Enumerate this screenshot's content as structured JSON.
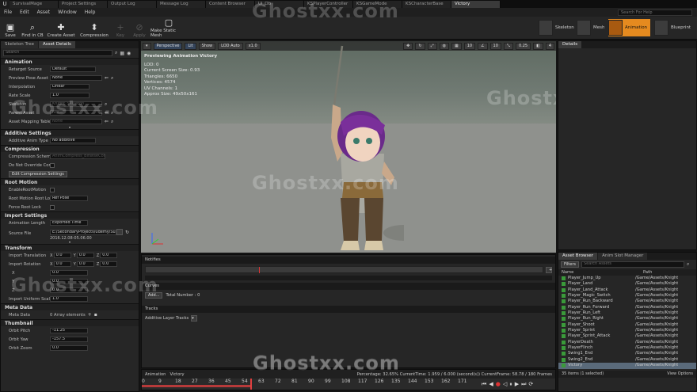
{
  "tabs": [
    "SurvivalMage",
    "Project Settings",
    "Output Log",
    "Message Log",
    "Content Browser",
    "Ui_Ob",
    "KSPlayerController",
    "KSGameMode",
    "KSCharacterBase",
    "Victory"
  ],
  "menu": [
    "File",
    "Edit",
    "Asset",
    "Window",
    "Help"
  ],
  "help_search": "Search For Help",
  "toolbar": {
    "save": "Save",
    "find": "Find in CB",
    "create": "Create Asset",
    "compression": "Compression",
    "key": "Key",
    "apply": "Apply",
    "static_mesh": "Make Static Mesh"
  },
  "modes": {
    "skeleton": "Skeleton",
    "mesh": "Mesh",
    "animation": "Animation",
    "blueprint": "Blueprint"
  },
  "left_tabs": [
    "Skeleton Tree",
    "Asset Details"
  ],
  "search_placeholder": "Search",
  "animation": {
    "header": "Animation",
    "retarget_label": "Retarget Source",
    "retarget_value": "Default",
    "preview_label": "Preview Pose Asset",
    "preview_value": "None",
    "interp_label": "Interpolation",
    "interp_value": "Linear",
    "rate_label": "Rate Scale",
    "rate_value": "1.0",
    "skeleton_label": "Skeleton",
    "skeleton_value": "Knight_Skeleton",
    "parent_label": "Parent Asset",
    "parent_value": "None",
    "mapping_label": "Asset Mapping Table",
    "mapping_value": "None"
  },
  "additive": {
    "header": "Additive Settings",
    "type_label": "Additive Anim Type",
    "type_value": "No additive"
  },
  "compression": {
    "header": "Compression",
    "scheme_label": "Compression Scheme",
    "scheme_value": "AnimCompress_BitwiseCompr",
    "override_label": "Do Not Override Com",
    "edit_btn": "Edit Compression Settings"
  },
  "root": {
    "header": "Root Motion",
    "enable_label": "EnableRootMotion",
    "lock_label": "Root Motion Root Loc",
    "lock_value": "Ref Pose",
    "force_label": "Force Root Lock"
  },
  "import": {
    "header": "Import Settings",
    "length_label": "Animation Length",
    "length_value": "Exported Time",
    "source_label": "Source File",
    "source_value": "E:/SecondaryProjects/udemy/Surviv",
    "source_date": "2016.12.08-05.06.00"
  },
  "transform": {
    "header": "Transform",
    "trans_label": "Import Translation",
    "rot_label": "Import Rotation",
    "uni_label": "Import Uniform Scale",
    "x": "X",
    "y": "Y",
    "z": "Z",
    "zero": "0.0",
    "one": "1.0"
  },
  "meta": {
    "header": "Meta Data",
    "label": "Meta Data",
    "value": "0 Array elements"
  },
  "thumb": {
    "header": "Thumbnail",
    "pitch_label": "Orbit Pitch",
    "pitch": "-11.25",
    "yaw_label": "Orbit Yaw",
    "yaw": "-157.5",
    "zoom_label": "Orbit Zoom",
    "zoom": "0.0"
  },
  "viewport": {
    "perspective": "Perspective",
    "lit": "Lit",
    "show": "Show",
    "lod": "LOD Auto",
    "speed": "x1.0",
    "grid": "10",
    "angle": "10",
    "scale": "0.25",
    "cam": "4",
    "stats": [
      "Previewing Animation Victory",
      "LOD: 0",
      "Current Screen Size: 0.93",
      "Triangles: 6650",
      "Vertices: 4574",
      "UV Channels: 1",
      "Approx Size: 49x50x161"
    ]
  },
  "notifies_label": "Notifies",
  "curves_label": "Curves",
  "add_btn": "Add...",
  "total": "Total Number : 0",
  "tracks_label": "Tracks",
  "additive_tracks": "Additive Layer Tracks",
  "timeline": {
    "anim": "Animation",
    "name": "Victory",
    "info": "Percentage: 32.65% CurrentTime: 1.959 / 6.000 (second(s)) CurrentFrame: 58.78 / 180 Frames",
    "ticks": [
      "0",
      "9",
      "18",
      "27",
      "36",
      "45",
      "54",
      "63",
      "72",
      "81",
      "90",
      "99",
      "108",
      "117",
      "126",
      "135",
      "144",
      "153",
      "162",
      "171"
    ]
  },
  "details_tab": "Details",
  "assets": {
    "tabs": [
      "Asset Browser",
      "Anim Slot Manager"
    ],
    "filters": "Filters",
    "search": "Search Assets",
    "col_name": "Name",
    "col_path": "Path",
    "items": [
      {
        "n": "Player_Jump_Up",
        "p": "/Game/Assets/Knight"
      },
      {
        "n": "Player_Land",
        "p": "/Game/Assets/Knight"
      },
      {
        "n": "Player_Land_Attack",
        "p": "/Game/Assets/Knight"
      },
      {
        "n": "Player_Magic_Switch",
        "p": "/Game/Assets/Knight"
      },
      {
        "n": "Player_Run_Backward",
        "p": "/Game/Assets/Knight"
      },
      {
        "n": "Player_Run_Forward",
        "p": "/Game/Assets/Knight"
      },
      {
        "n": "Player_Run_Left",
        "p": "/Game/Assets/Knight"
      },
      {
        "n": "Player_Run_Right",
        "p": "/Game/Assets/Knight"
      },
      {
        "n": "Player_Shoot",
        "p": "/Game/Assets/Knight"
      },
      {
        "n": "Player_Sprint",
        "p": "/Game/Assets/Knight"
      },
      {
        "n": "Player_Sprint_Attack",
        "p": "/Game/Assets/Knight"
      },
      {
        "n": "PlayerDeath",
        "p": "/Game/Assets/Knight"
      },
      {
        "n": "PlayerFlinch",
        "p": "/Game/Assets/Knight"
      },
      {
        "n": "Swing1_End",
        "p": "/Game/Assets/Knight"
      },
      {
        "n": "Swing2_End",
        "p": "/Game/Assets/Knight"
      },
      {
        "n": "Victory",
        "p": "/Game/Assets/Knight"
      }
    ],
    "count": "35 items (1 selected)",
    "view": "View Options"
  },
  "watermark": "Ghostxx.com"
}
